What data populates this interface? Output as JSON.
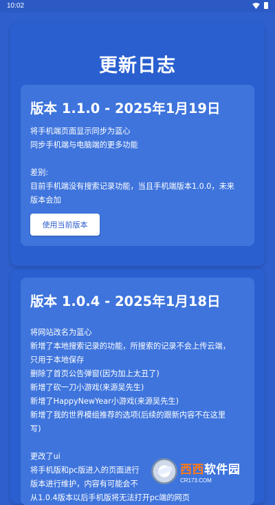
{
  "status_bar": {
    "time": "10:02"
  },
  "page": {
    "title": "更新日志"
  },
  "changelog": [
    {
      "title": "版本 1.1.0 - 2025年1月19日",
      "lines": [
        "将手机端页面显示同步为蓝心",
        "同步手机端与电脑端的更多功能",
        "",
        "差别:",
        "目前手机端没有搜索记录功能，当且手机端版本1.0.0，未来",
        "版本会加"
      ],
      "button_label": "使用当前版本"
    },
    {
      "title": "版本 1.0.4 - 2025年1月18日",
      "lines": [
        "将网站改名为蓝心",
        "新增了本地搜索记录的功能，所搜索的记录不会上传云端，",
        "只用于本地保存",
        "删除了首页公告弹窗(因为加上太丑了)",
        "新增了砍一刀小游戏(来源吴先生)",
        "新增了HappyNewYear小游戏(来源吴先生)",
        "新增了我的世界模组推荐的选项(后续的跟新内容不在这里",
        "写)",
        "",
        "更改了ui",
        "将手机版和pc版进入的页面进行",
        "版本进行维护，内容有可能会不",
        "从1.0.4版本以后手机版将无法打开pc端的网页"
      ]
    }
  ],
  "watermark": {
    "brand_a": "西西",
    "brand_b": "软件园",
    "url": "CR173.COM"
  },
  "colors": {
    "background": "#2e5fcd",
    "card": "#3e74dc",
    "button_text": "#2f5fcf"
  }
}
